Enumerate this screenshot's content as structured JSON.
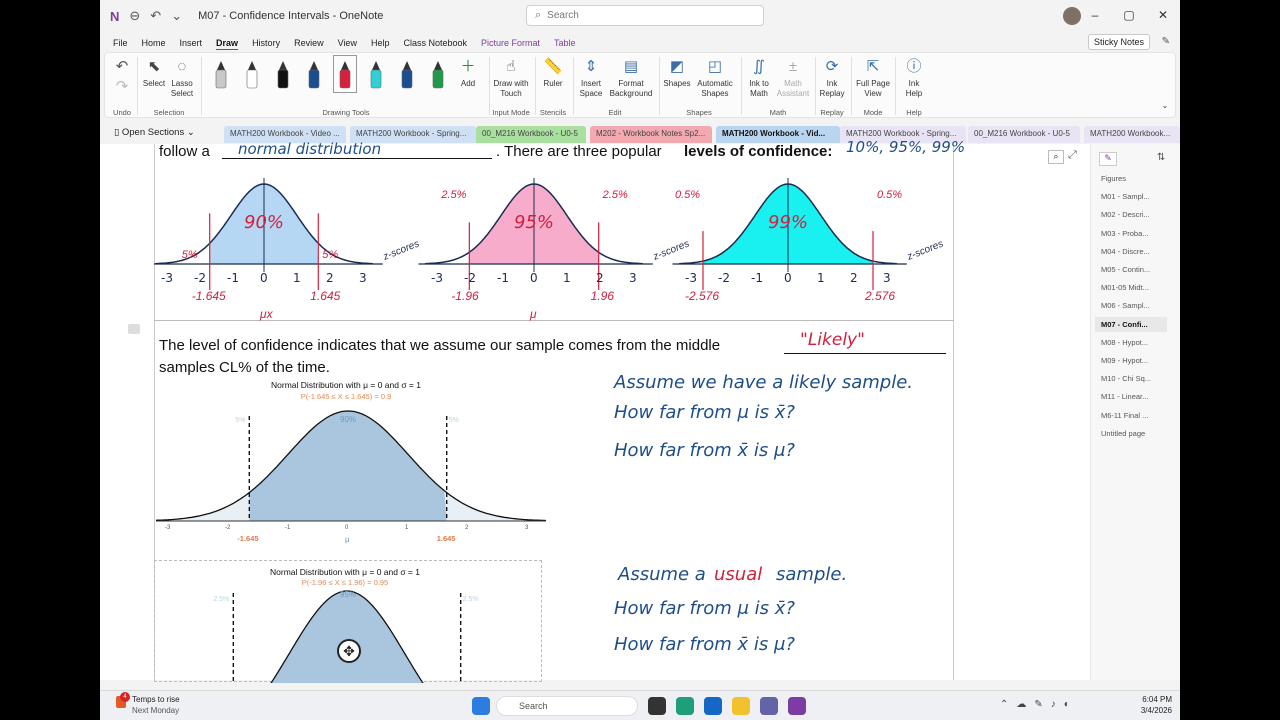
{
  "window": {
    "title": "M07 - Confidence Intervals - OneNote",
    "search_placeholder": "Search",
    "min": "–",
    "max": "▢",
    "close": "✕"
  },
  "menu": {
    "items": [
      "File",
      "Home",
      "Insert",
      "Draw",
      "History",
      "Review",
      "View",
      "Help",
      "Class Notebook",
      "Picture Format",
      "Table"
    ],
    "active": "Draw",
    "sticky": "Sticky Notes"
  },
  "ribbon": {
    "undo": "Undo",
    "select": "Select",
    "lasso": "Lasso\nSelect",
    "selection_group": "Selection",
    "drawing_tools_group": "Drawing Tools",
    "add": "Add",
    "draw_touch": "Draw with\nTouch",
    "input_mode_group": "Input Mode",
    "ruler": "Ruler",
    "stencils_group": "Stencils",
    "insert_space": "Insert\nSpace",
    "format_bg": "Format\nBackground",
    "edit_group": "Edit",
    "shapes": "Shapes",
    "auto_shapes": "Automatic\nShapes",
    "shapes_group": "Shapes",
    "ink_math": "Ink to\nMath",
    "math_assist": "Math\nAssistant",
    "math_group": "Math",
    "ink_replay": "Ink\nReplay",
    "replay_group": "Replay",
    "full_page": "Full Page\nView",
    "mode_group": "Mode",
    "ink_help": "Ink\nHelp",
    "help_group": "Help"
  },
  "pens": [
    "#c8c8c8",
    "#ffffff",
    "#111111",
    "#1b4e8f",
    "#d81f3d",
    "#2fd0d6",
    "#1b4e8f",
    "#1e9a4a"
  ],
  "section_tabs": [
    {
      "label": "Open Sections"
    },
    {
      "label": "MATH200 Workbook - Video ...",
      "color": "#cfe0f5"
    },
    {
      "label": "MATH200 Workbook - Spring...",
      "color": "#cfe0f5"
    },
    {
      "label": "00_M216 Workbook - U0-5",
      "color": "#a9e0a0"
    },
    {
      "label": "M202 - Workbook Notes Sp2...",
      "color": "#f2a9b0"
    },
    {
      "label": "MATH200 Workbook - Vid...",
      "color": "#b9d5f0"
    },
    {
      "label": "MATH200 Workbook - Spring...",
      "color": "#e9e4f5"
    },
    {
      "label": "00_M216 Workbook - U0-5",
      "color": "#e9e4f5"
    },
    {
      "label": "MATH200 Workbook...",
      "color": "#e9e4f5"
    }
  ],
  "pages": [
    "Figures",
    "M01 - Sampl...",
    "M02 - Descri...",
    "M03 - Proba...",
    "M04 - Discre...",
    "M05 - Contin...",
    "M01-05 Midt...",
    "M06 - Sampl...",
    "M07 - Confi...",
    "M08 - Hypot...",
    "M09 - Hypot...",
    "M10 - Chi Sq...",
    "M11 - Linear...",
    "M6-11 Final ...",
    "Untitled page"
  ],
  "selected_page": "M07 - Confi...",
  "content": {
    "top_line_a": "follow a",
    "top_line_b": ". There are three popular",
    "top_line_bold": "levels of confidence:",
    "hand_normal": "normal distribution",
    "hand_levels": "10%, 95%, 99%",
    "level_sentence": "The level of confidence indicates that we assume our sample comes from the middle",
    "hand_likely": "\"Likely\"",
    "samples_line": "samples CL% of the time.",
    "hand_a1": "Assume we have a likely sample.",
    "hand_a2": "How far from μ is x̄?",
    "hand_a3": "How far from x̄ is μ?",
    "hand_b1a": "Assume a",
    "hand_b1b": "usual",
    "hand_b1c": "sample.",
    "hand_b2": "How far from μ is x̄?",
    "hand_b3": "How far from x̄ is μ?"
  },
  "sketches": [
    {
      "pct": "90%",
      "tail": "5%",
      "crit": "1.645",
      "ncrit": "-1.645",
      "color": "#aed3f3",
      "mid_label": "μx"
    },
    {
      "pct": "95%",
      "tail": "2.5%",
      "crit": "1.96",
      "ncrit": "-1.96",
      "color": "#f7a3c6",
      "mid_label": "μ"
    },
    {
      "pct": "99%",
      "tail": "0.5%",
      "crit": "2.576",
      "ncrit": "-2.576",
      "color": "#00f0f0",
      "mid_label": ""
    }
  ],
  "zscores": "z-scores",
  "ticks": [
    "-3",
    "-2",
    "-1",
    "0",
    "1",
    "2",
    "3"
  ],
  "fig1": {
    "title": "Normal Distribution with μ = 0 and σ = 1",
    "subtitle": "P(-1.645 ≤ X ≤ 1.645) = 0.9",
    "center": "90%",
    "left": "5%",
    "right": "5%",
    "lcrit": "-1.645",
    "rcrit": "1.645",
    "mu": "μ",
    "ticks": [
      "-3",
      "-2",
      "-1",
      "0",
      "1",
      "2",
      "3"
    ]
  },
  "fig2": {
    "title": "Normal Distribution with μ = 0 and σ = 1",
    "subtitle": "P(-1.96 ≤ X ≤ 1.96) = 0.95",
    "center": "95%",
    "left": "2.5%",
    "right": "2.5%"
  },
  "taskbar": {
    "weather": "Temps to rise",
    "weather2": "Next Monday",
    "search": "Search",
    "time": "6:04 PM",
    "date": "3/4/2026",
    "notif": "4"
  }
}
